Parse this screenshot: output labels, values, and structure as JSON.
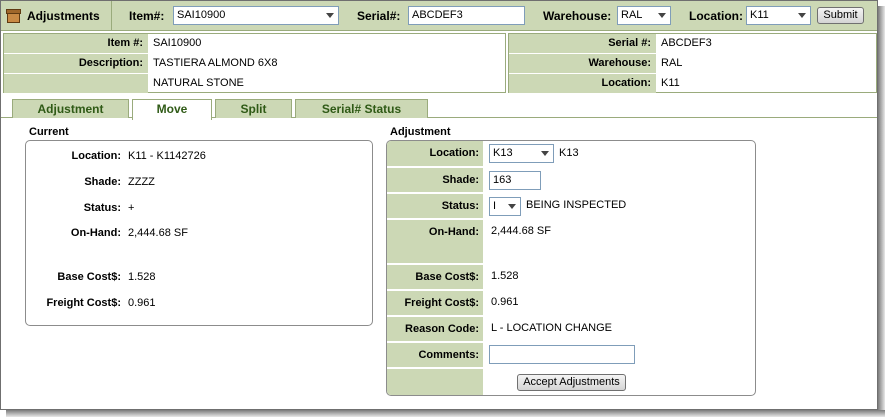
{
  "toolbar": {
    "title": "Adjustments",
    "item_label": "Item#:",
    "item_value": "SAI10900",
    "serial_label": "Serial#:",
    "serial_value": "ABCDEF3",
    "warehouse_label": "Warehouse:",
    "warehouse_value": "RAL",
    "location_label": "Location:",
    "location_value": "K11",
    "submit_label": "Submit"
  },
  "info": {
    "item_label": "Item #:",
    "item_value": "SAI10900",
    "description_label": "Description:",
    "description_value": "TASTIERA ALMOND 6X8",
    "description_value2": "NATURAL STONE",
    "serial_label": "Serial #:",
    "serial_value": "ABCDEF3",
    "warehouse_label": "Warehouse:",
    "warehouse_value": "RAL",
    "location_label": "Location:",
    "location_value": "K11"
  },
  "tabs": [
    {
      "label": "Adjustment"
    },
    {
      "label": "Move"
    },
    {
      "label": "Split"
    },
    {
      "label": "Serial# Status"
    }
  ],
  "current": {
    "title": "Current",
    "location_label": "Location:",
    "location_value": "K11 - K1142726",
    "shade_label": "Shade:",
    "shade_value": "ZZZZ",
    "status_label": "Status:",
    "status_value": "+",
    "onhand_label": "On-Hand:",
    "onhand_value": "2,444.68 SF",
    "basecost_label": "Base Cost$:",
    "basecost_value": "1.528",
    "freight_label": "Freight Cost$:",
    "freight_value": "0.961"
  },
  "adjustment": {
    "title": "Adjustment",
    "location_label": "Location:",
    "location_select": "K13",
    "location_text": "K13",
    "shade_label": "Shade:",
    "shade_value": "163",
    "status_label": "Status:",
    "status_select": "I",
    "status_text": "BEING INSPECTED",
    "onhand_label": "On-Hand:",
    "onhand_value": "2,444.68 SF",
    "basecost_label": "Base Cost$:",
    "basecost_value": "1.528",
    "freight_label": "Freight Cost$:",
    "freight_value": "0.961",
    "reason_label": "Reason Code:",
    "reason_value": "L - LOCATION CHANGE",
    "comments_label": "Comments:",
    "comments_value": "",
    "accept_label": "Accept Adjustments"
  },
  "icons": {
    "app": "box-icon",
    "dropdown": "chevron-down-icon"
  },
  "colors": {
    "header_bg": "#ccd8b5",
    "tab_text": "#2f5a16",
    "border": "#9aab7c"
  }
}
